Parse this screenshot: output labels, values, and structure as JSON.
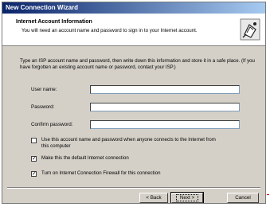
{
  "window": {
    "title": "New Connection Wizard"
  },
  "header": {
    "title": "Internet Account Information",
    "subtitle": "You will need an account name and password to sign in to your Internet account."
  },
  "intro_text": "Type an ISP account name and password, then write down this information and store it in a safe place. (If you have forgotten an existing account name or password, contact your ISP.)",
  "fields": {
    "user_name_label": "User name:",
    "password_label": "Password:",
    "confirm_label": "Confirm password:",
    "user_name_value": "",
    "password_value": "",
    "confirm_value": ""
  },
  "options": {
    "use_account_line1": "Use this account  name and password when anyone connects to the Internet from",
    "use_account_line2": "this computer",
    "use_account_checked": false,
    "default_connection": "Make this the default Internet connection",
    "default_connection_checked": true,
    "firewall": "Turn on Internet Connection Firewall for this connection",
    "firewall_checked": true
  },
  "buttons": {
    "back": "< Back",
    "next": "Next >",
    "cancel": "Cancel"
  },
  "icons": {
    "wizard": "connection-wizard-icon",
    "check": "check-mark-icon"
  }
}
